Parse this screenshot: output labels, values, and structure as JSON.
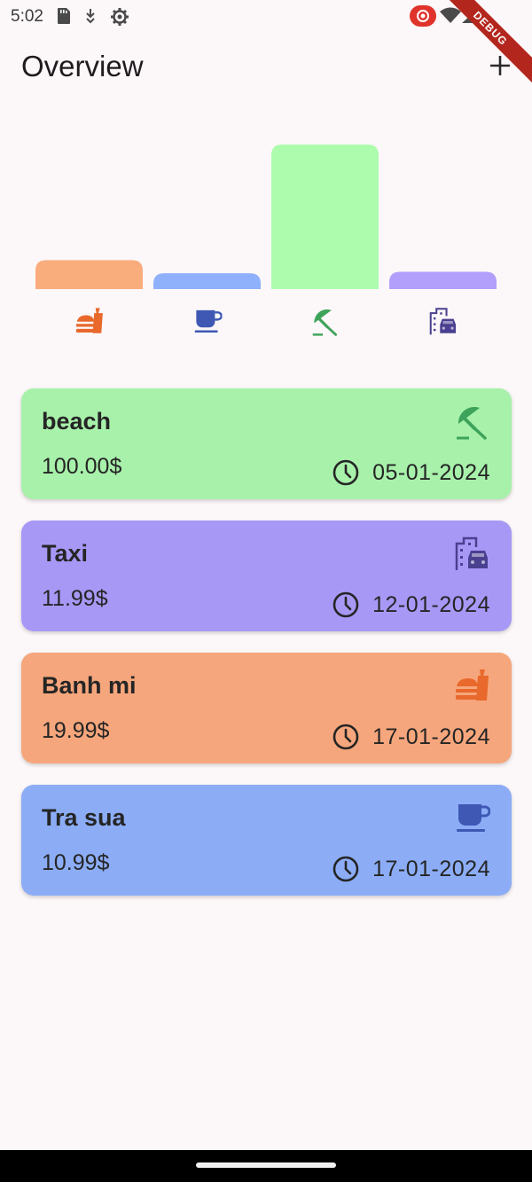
{
  "status_bar": {
    "time": "5:02",
    "icons": [
      "sd-card-icon",
      "download-arrows-icon",
      "settings-gear-icon",
      "screen-record-icon",
      "wifi-icon",
      "signal-icon"
    ],
    "debug_label": "DEBUG"
  },
  "app_bar": {
    "title": "Overview",
    "add_icon": "plus-icon"
  },
  "chart_data": {
    "type": "bar",
    "categories": [
      "food",
      "drink",
      "travel",
      "transport"
    ],
    "category_icons": [
      "fastfood-icon",
      "cup-icon",
      "umbrella-icon",
      "car-city-icon"
    ],
    "values": [
      19.99,
      10.99,
      100.0,
      11.99
    ],
    "colors": [
      "#f9ad7c",
      "#8fb1fc",
      "#adfcae",
      "#b19ffb"
    ],
    "icon_colors": [
      "#e8692b",
      "#3e58b4",
      "#3ea35a",
      "#4a4090"
    ],
    "ylim": [
      0,
      100
    ],
    "grid": false,
    "title": "",
    "xlabel": "",
    "ylabel": ""
  },
  "expenses": [
    {
      "title": "beach",
      "amount": "100.00$",
      "date": "05-01-2024",
      "icon": "umbrella-icon",
      "bg": "#a8f1ab",
      "icon_color": "#3ea35a"
    },
    {
      "title": "Taxi",
      "amount": "11.99$",
      "date": "12-01-2024",
      "icon": "car-city-icon",
      "bg": "#a898f6",
      "icon_color": "#4a4090"
    },
    {
      "title": "Banh mi",
      "amount": "19.99$",
      "date": "17-01-2024",
      "icon": "fastfood-icon",
      "bg": "#f6a67c",
      "icon_color": "#e8692b"
    },
    {
      "title": "Tra sua",
      "amount": "10.99$",
      "date": "17-01-2024",
      "icon": "cup-icon",
      "bg": "#8cadf6",
      "icon_color": "#3e58b4"
    }
  ]
}
